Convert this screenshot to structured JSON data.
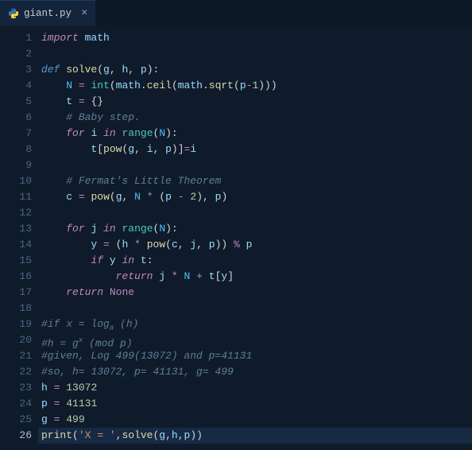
{
  "tab": {
    "filename": "giant.py",
    "icon": "python-icon"
  },
  "editor": {
    "active_line": 26,
    "lines": [
      {
        "n": 1,
        "tokens": [
          [
            "kw",
            "import"
          ],
          [
            "pun",
            " "
          ],
          [
            "var",
            "math"
          ]
        ]
      },
      {
        "n": 2,
        "tokens": []
      },
      {
        "n": 3,
        "tokens": [
          [
            "def",
            "def "
          ],
          [
            "fn",
            "solve"
          ],
          [
            "pun",
            "("
          ],
          [
            "var",
            "g"
          ],
          [
            "pun",
            ", "
          ],
          [
            "var",
            "h"
          ],
          [
            "pun",
            ", "
          ],
          [
            "var",
            "p"
          ],
          [
            "pun",
            "):"
          ]
        ]
      },
      {
        "n": 4,
        "tokens": [
          [
            "pun",
            "    "
          ],
          [
            "const",
            "N"
          ],
          [
            "pun",
            " "
          ],
          [
            "op",
            "="
          ],
          [
            "pun",
            " "
          ],
          [
            "cls",
            "int"
          ],
          [
            "pun",
            "("
          ],
          [
            "var",
            "math"
          ],
          [
            "pun",
            "."
          ],
          [
            "fn",
            "ceil"
          ],
          [
            "pun",
            "("
          ],
          [
            "var",
            "math"
          ],
          [
            "pun",
            "."
          ],
          [
            "fn",
            "sqrt"
          ],
          [
            "pun",
            "("
          ],
          [
            "var",
            "p"
          ],
          [
            "op",
            "-"
          ],
          [
            "num",
            "1"
          ],
          [
            "pun",
            ")))"
          ]
        ]
      },
      {
        "n": 5,
        "tokens": [
          [
            "pun",
            "    "
          ],
          [
            "var",
            "t"
          ],
          [
            "pun",
            " "
          ],
          [
            "op",
            "="
          ],
          [
            "pun",
            " {}"
          ]
        ]
      },
      {
        "n": 6,
        "tokens": [
          [
            "pun",
            "    "
          ],
          [
            "cmt",
            "# Baby step."
          ]
        ]
      },
      {
        "n": 7,
        "tokens": [
          [
            "pun",
            "    "
          ],
          [
            "kw",
            "for"
          ],
          [
            "pun",
            " "
          ],
          [
            "var",
            "i"
          ],
          [
            "pun",
            " "
          ],
          [
            "kw",
            "in"
          ],
          [
            "pun",
            " "
          ],
          [
            "cls",
            "range"
          ],
          [
            "pun",
            "("
          ],
          [
            "const",
            "N"
          ],
          [
            "pun",
            "):"
          ]
        ]
      },
      {
        "n": 8,
        "tokens": [
          [
            "pun",
            "        "
          ],
          [
            "var",
            "t"
          ],
          [
            "pun",
            "["
          ],
          [
            "fn",
            "pow"
          ],
          [
            "pun",
            "("
          ],
          [
            "var",
            "g"
          ],
          [
            "pun",
            ", "
          ],
          [
            "var",
            "i"
          ],
          [
            "pun",
            ", "
          ],
          [
            "var",
            "p"
          ],
          [
            "pun",
            ")]"
          ],
          [
            "op",
            "="
          ],
          [
            "var",
            "i"
          ]
        ]
      },
      {
        "n": 9,
        "tokens": []
      },
      {
        "n": 10,
        "tokens": [
          [
            "pun",
            "    "
          ],
          [
            "cmt",
            "# Fermat's Little Theorem"
          ]
        ]
      },
      {
        "n": 11,
        "tokens": [
          [
            "pun",
            "    "
          ],
          [
            "var",
            "c"
          ],
          [
            "pun",
            " "
          ],
          [
            "op",
            "="
          ],
          [
            "pun",
            " "
          ],
          [
            "fn",
            "pow"
          ],
          [
            "pun",
            "("
          ],
          [
            "var",
            "g"
          ],
          [
            "pun",
            ", "
          ],
          [
            "const",
            "N"
          ],
          [
            "pun",
            " "
          ],
          [
            "op",
            "*"
          ],
          [
            "pun",
            " ("
          ],
          [
            "var",
            "p"
          ],
          [
            "pun",
            " "
          ],
          [
            "op",
            "-"
          ],
          [
            "pun",
            " "
          ],
          [
            "num",
            "2"
          ],
          [
            "pun",
            "), "
          ],
          [
            "var",
            "p"
          ],
          [
            "pun",
            ")"
          ]
        ]
      },
      {
        "n": 12,
        "tokens": []
      },
      {
        "n": 13,
        "tokens": [
          [
            "pun",
            "    "
          ],
          [
            "kw",
            "for"
          ],
          [
            "pun",
            " "
          ],
          [
            "var",
            "j"
          ],
          [
            "pun",
            " "
          ],
          [
            "kw",
            "in"
          ],
          [
            "pun",
            " "
          ],
          [
            "cls",
            "range"
          ],
          [
            "pun",
            "("
          ],
          [
            "const",
            "N"
          ],
          [
            "pun",
            "):"
          ]
        ]
      },
      {
        "n": 14,
        "tokens": [
          [
            "pun",
            "        "
          ],
          [
            "var",
            "y"
          ],
          [
            "pun",
            " "
          ],
          [
            "op",
            "="
          ],
          [
            "pun",
            " ("
          ],
          [
            "var",
            "h"
          ],
          [
            "pun",
            " "
          ],
          [
            "op",
            "*"
          ],
          [
            "pun",
            " "
          ],
          [
            "fn",
            "pow"
          ],
          [
            "pun",
            "("
          ],
          [
            "var",
            "c"
          ],
          [
            "pun",
            ", "
          ],
          [
            "var",
            "j"
          ],
          [
            "pun",
            ", "
          ],
          [
            "var",
            "p"
          ],
          [
            "pun",
            ")) "
          ],
          [
            "op",
            "%"
          ],
          [
            "pun",
            " "
          ],
          [
            "var",
            "p"
          ]
        ]
      },
      {
        "n": 15,
        "tokens": [
          [
            "pun",
            "        "
          ],
          [
            "kw",
            "if"
          ],
          [
            "pun",
            " "
          ],
          [
            "var",
            "y"
          ],
          [
            "pun",
            " "
          ],
          [
            "kw",
            "in"
          ],
          [
            "pun",
            " "
          ],
          [
            "var",
            "t"
          ],
          [
            "pun",
            ":"
          ]
        ]
      },
      {
        "n": 16,
        "tokens": [
          [
            "pun",
            "            "
          ],
          [
            "kw",
            "return"
          ],
          [
            "pun",
            " "
          ],
          [
            "var",
            "j"
          ],
          [
            "pun",
            " "
          ],
          [
            "op",
            "*"
          ],
          [
            "pun",
            " "
          ],
          [
            "const",
            "N"
          ],
          [
            "pun",
            " "
          ],
          [
            "op",
            "+"
          ],
          [
            "pun",
            " "
          ],
          [
            "var",
            "t"
          ],
          [
            "pun",
            "["
          ],
          [
            "var",
            "y"
          ],
          [
            "pun",
            "]"
          ]
        ]
      },
      {
        "n": 17,
        "tokens": [
          [
            "pun",
            "    "
          ],
          [
            "kw",
            "return"
          ],
          [
            "pun",
            " "
          ],
          [
            "none",
            "None"
          ]
        ]
      },
      {
        "n": 18,
        "tokens": []
      },
      {
        "n": 19,
        "tokens": [
          [
            "cmt",
            "#if x = log"
          ],
          [
            "cmt-sub",
            "a"
          ],
          [
            "cmt",
            " (h)"
          ]
        ]
      },
      {
        "n": 20,
        "tokens": [
          [
            "cmt",
            "#h = g"
          ],
          [
            "cmt-sup",
            "x"
          ],
          [
            "cmt",
            " (mod p)"
          ]
        ]
      },
      {
        "n": 21,
        "tokens": [
          [
            "cmt",
            "#given, Log 499(13072) and p=41131"
          ]
        ]
      },
      {
        "n": 22,
        "tokens": [
          [
            "cmt",
            "#so, h= 13072, p= 41131, g= 499"
          ]
        ]
      },
      {
        "n": 23,
        "tokens": [
          [
            "var",
            "h"
          ],
          [
            "pun",
            " "
          ],
          [
            "op",
            "="
          ],
          [
            "pun",
            " "
          ],
          [
            "num",
            "13072"
          ]
        ]
      },
      {
        "n": 24,
        "tokens": [
          [
            "var",
            "p"
          ],
          [
            "pun",
            " "
          ],
          [
            "op",
            "="
          ],
          [
            "pun",
            " "
          ],
          [
            "num",
            "41131"
          ]
        ]
      },
      {
        "n": 25,
        "tokens": [
          [
            "var",
            "g"
          ],
          [
            "pun",
            " "
          ],
          [
            "op",
            "="
          ],
          [
            "pun",
            " "
          ],
          [
            "num",
            "499"
          ]
        ]
      },
      {
        "n": 26,
        "tokens": [
          [
            "fn",
            "print"
          ],
          [
            "pun",
            "("
          ],
          [
            "str",
            "'X = '"
          ],
          [
            "pun",
            ","
          ],
          [
            "fn",
            "solve"
          ],
          [
            "pun",
            "("
          ],
          [
            "var",
            "g"
          ],
          [
            "pun",
            ","
          ],
          [
            "var",
            "h"
          ],
          [
            "pun",
            ","
          ],
          [
            "var",
            "p"
          ],
          [
            "pun",
            "))"
          ]
        ]
      }
    ]
  }
}
